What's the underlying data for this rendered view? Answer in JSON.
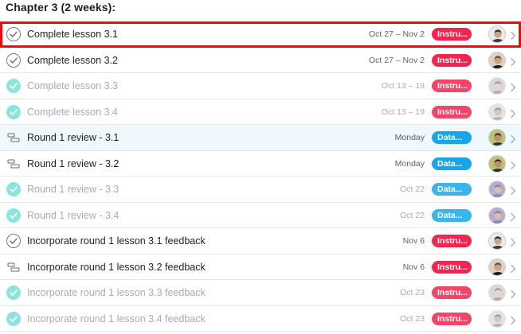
{
  "section": {
    "title": "Chapter 3 (2 weeks):"
  },
  "colors": {
    "tag_red": "#f0264e",
    "tag_blue": "#19a6e8",
    "check_filled": "#8de4da",
    "selection_outline": "#f1080c"
  },
  "tasks": [
    {
      "name": "Complete lesson 3.1",
      "status": "checkmark-outline-icon",
      "completed": false,
      "due": "Oct 27 – Nov 2",
      "tag": "Instru...",
      "tag_color": "#f0264e",
      "avatar": "avatar-a",
      "selected": true,
      "highlighted": false
    },
    {
      "name": "Complete lesson 3.2",
      "status": "checkmark-outline-icon",
      "completed": false,
      "due": "Oct 27 – Nov 2",
      "tag": "Instru...",
      "tag_color": "#f0264e",
      "avatar": "avatar-b",
      "selected": false,
      "highlighted": false
    },
    {
      "name": "Complete lesson 3.3",
      "status": "checkmark-filled-icon",
      "completed": true,
      "due": "Oct 13 – 19",
      "tag": "Instru...",
      "tag_color": "#f0264e",
      "avatar": "avatar-c",
      "selected": false,
      "highlighted": false
    },
    {
      "name": "Complete lesson 3.4",
      "status": "checkmark-filled-icon",
      "completed": true,
      "due": "Oct 13 – 19",
      "tag": "Instru...",
      "tag_color": "#f0264e",
      "avatar": "avatar-d",
      "selected": false,
      "highlighted": false
    },
    {
      "name": "Round 1 review - 3.1",
      "status": "milestone-icon",
      "completed": false,
      "due": "Monday",
      "tag": "Data...",
      "tag_color": "#19a6e8",
      "avatar": "avatar-e",
      "selected": false,
      "highlighted": true
    },
    {
      "name": "Round 1 review - 3.2",
      "status": "milestone-icon",
      "completed": false,
      "due": "Monday",
      "tag": "Data...",
      "tag_color": "#19a6e8",
      "avatar": "avatar-e",
      "selected": false,
      "highlighted": false
    },
    {
      "name": "Round 1 review - 3.3",
      "status": "checkmark-filled-icon",
      "completed": true,
      "due": "Oct 22",
      "tag": "Data...",
      "tag_color": "#19a6e8",
      "avatar": "avatar-f",
      "selected": false,
      "highlighted": false
    },
    {
      "name": "Round 1 review - 3.4",
      "status": "checkmark-filled-icon",
      "completed": true,
      "due": "Oct 22",
      "tag": "Data...",
      "tag_color": "#19a6e8",
      "avatar": "avatar-f",
      "selected": false,
      "highlighted": false
    },
    {
      "name": "Incorporate round 1 lesson 3.1 feedback",
      "status": "checkmark-outline-icon",
      "completed": false,
      "due": "Nov 6",
      "tag": "Instru...",
      "tag_color": "#f0264e",
      "avatar": "avatar-a",
      "selected": false,
      "highlighted": false
    },
    {
      "name": "Incorporate round 1 lesson 3.2 feedback",
      "status": "milestone-icon",
      "completed": false,
      "due": "Nov 6",
      "tag": "Instru...",
      "tag_color": "#f0264e",
      "avatar": "avatar-b",
      "selected": false,
      "highlighted": false
    },
    {
      "name": "Incorporate round 1 lesson 3.3 feedback",
      "status": "checkmark-filled-icon",
      "completed": true,
      "due": "Oct 23",
      "tag": "Instru...",
      "tag_color": "#f0264e",
      "avatar": "avatar-c",
      "selected": false,
      "highlighted": false
    },
    {
      "name": "Incorporate round 1 lesson 3.4 feedback",
      "status": "checkmark-filled-icon",
      "completed": true,
      "due": "Oct 23",
      "tag": "Instru...",
      "tag_color": "#f0264e",
      "avatar": "avatar-d",
      "selected": false,
      "highlighted": false
    }
  ]
}
